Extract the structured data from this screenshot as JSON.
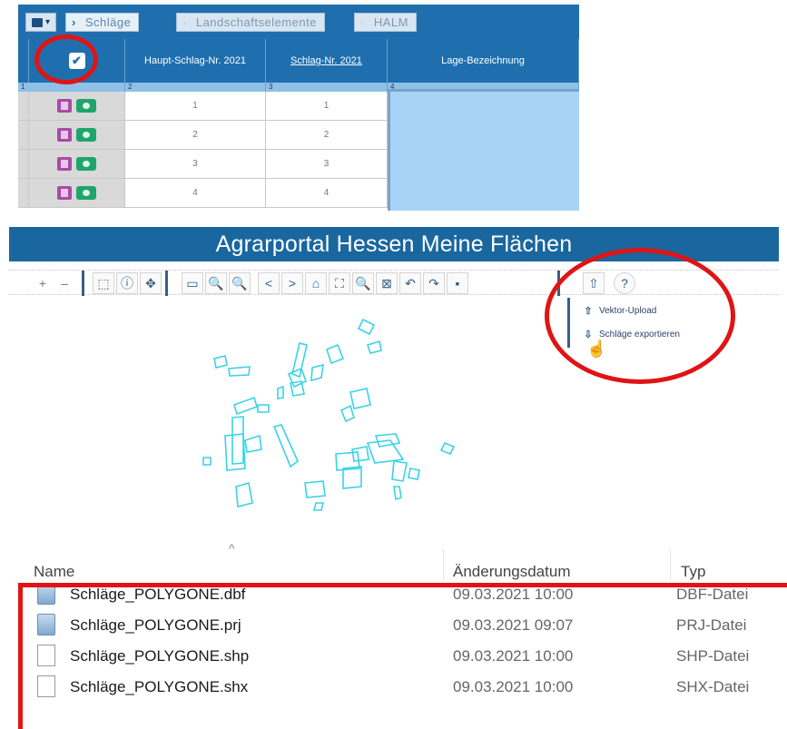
{
  "grid": {
    "menu_arrow": "▾",
    "breadcrumbs": [
      {
        "label": "Schläge",
        "active": true
      },
      {
        "label": "Landschaftselemente",
        "active": false
      },
      {
        "label": "HALM",
        "active": false
      }
    ],
    "headers": {
      "select_icon": "check-badge-icon",
      "select_glyph": "✔",
      "haupt_schlag_nr": "Haupt-Schlag-Nr. 2021",
      "schlag_nr": "Schlag-Nr. 2021",
      "lage_bezeichnung": "Lage-Bezeichnung"
    },
    "index_row": [
      "1",
      "2",
      "3",
      "4"
    ],
    "rows": [
      {
        "haupt": "1",
        "schlag": "1"
      },
      {
        "haupt": "2",
        "schlag": "2"
      },
      {
        "haupt": "3",
        "schlag": "3"
      },
      {
        "haupt": "4",
        "schlag": "4"
      }
    ]
  },
  "map": {
    "title": "Agrarportal Hessen  Meine Flächen",
    "toolbar": {
      "zoom_in": "+",
      "zoom_out": "–",
      "info": "ⓘ",
      "move": "✥",
      "measure": "▭",
      "zoom": "🔍",
      "zoom2": "🔍",
      "prev": "<",
      "next": ">",
      "home": "⌂",
      "extent": "⛶",
      "search": "🔍",
      "clear": "⊠",
      "undo": "↶",
      "redo": "↷",
      "print": "▪",
      "upload": "⇧",
      "help": "?"
    },
    "upload_menu": [
      {
        "label": "Vektor-Upload",
        "icon": "upload-icon",
        "glyph": "⇧"
      },
      {
        "label": "Schläge exportieren",
        "icon": "download-icon",
        "glyph": "⇩"
      }
    ],
    "polygon_color": "#39d3e6"
  },
  "files": {
    "sort_indicator": "^",
    "columns": {
      "name": "Name",
      "date": "Änderungsdatum",
      "type": "Typ"
    },
    "rows": [
      {
        "name": "Schläge_POLYGONE.dbf",
        "date": "09.03.2021 10:00",
        "type": "DBF-Datei",
        "icon": "database-file-icon"
      },
      {
        "name": "Schläge_POLYGONE.prj",
        "date": "09.03.2021 09:07",
        "type": "PRJ-Datei",
        "icon": "database-file-icon"
      },
      {
        "name": "Schläge_POLYGONE.shp",
        "date": "09.03.2021 10:00",
        "type": "SHP-Datei",
        "icon": "blank-file-icon"
      },
      {
        "name": "Schläge_POLYGONE.shx",
        "date": "09.03.2021 10:00",
        "type": "SHX-Datei",
        "icon": "blank-file-icon"
      }
    ]
  },
  "annotation_color": "#e01414"
}
